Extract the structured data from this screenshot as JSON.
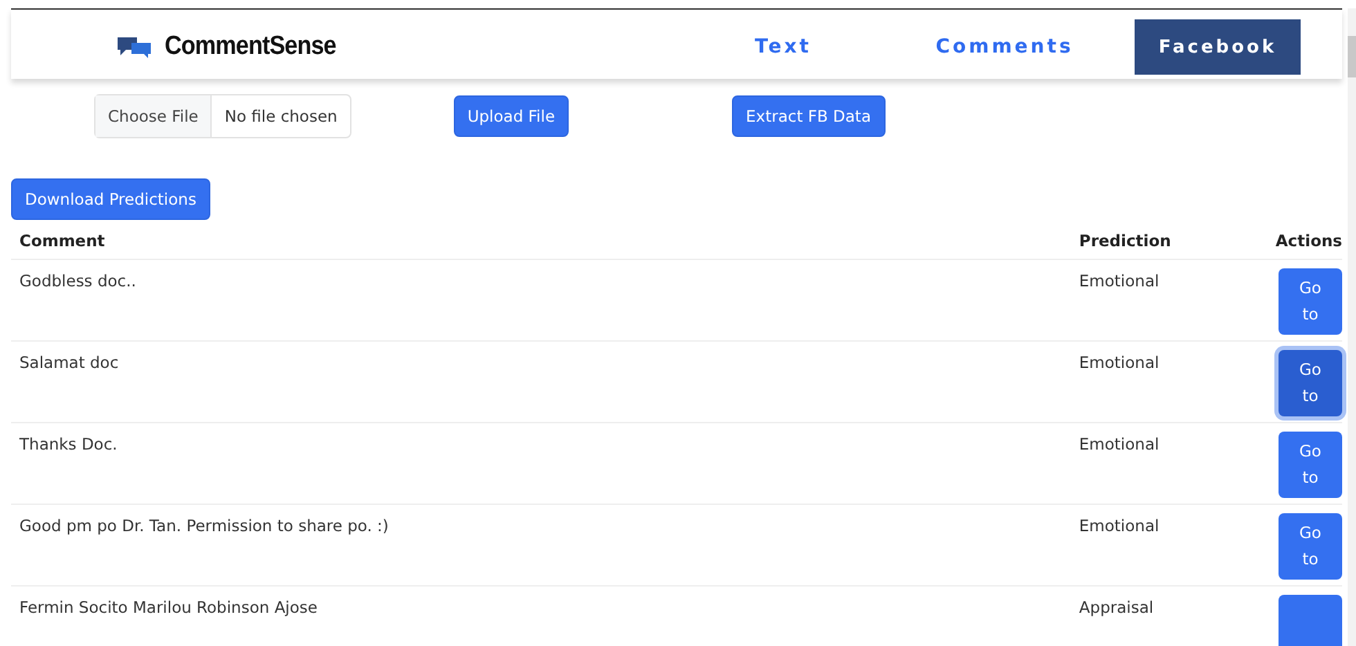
{
  "brand": {
    "name": "CommentSense"
  },
  "tabs": [
    {
      "label": "Text",
      "selected": false
    },
    {
      "label": "Comments",
      "selected": false
    },
    {
      "label": "Facebook",
      "selected": true
    }
  ],
  "file_input": {
    "button": "Choose File",
    "status": "No file chosen"
  },
  "upload_button": "Upload File",
  "extract_button": "Extract FB Data",
  "download_button": "Download Predictions",
  "table": {
    "columns": [
      "Comment",
      "Prediction",
      "Actions"
    ],
    "rows": [
      {
        "comment": "Godbless doc..",
        "prediction": "Emotional",
        "action": "Go to",
        "focused": false
      },
      {
        "comment": "Salamat doc",
        "prediction": "Emotional",
        "action": "Go to",
        "focused": true
      },
      {
        "comment": "Thanks Doc.",
        "prediction": "Emotional",
        "action": "Go to",
        "focused": false
      },
      {
        "comment": "Good pm po Dr. Tan. Permission to share po. :)",
        "prediction": "Emotional",
        "action": "Go to",
        "focused": false
      },
      {
        "comment": "Fermin Socito Marilou Robinson Ajose",
        "prediction": "Appraisal",
        "focused": false
      }
    ]
  }
}
